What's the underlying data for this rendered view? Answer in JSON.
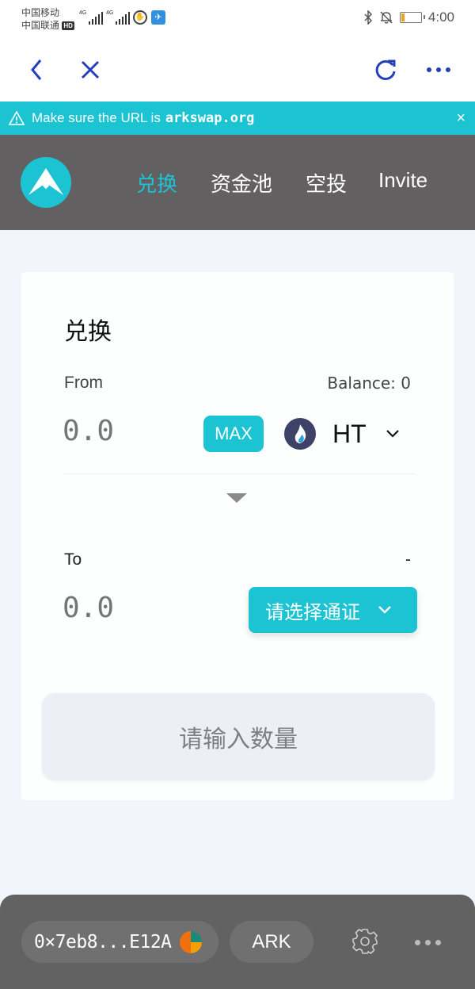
{
  "status_bar": {
    "carrier_1": "中国移动",
    "carrier_2": "中国联通",
    "hd_badge": "HD",
    "network_1": "4G",
    "network_2": "4G",
    "battery_level_percent": 15,
    "time": "4:00"
  },
  "browser": {
    "back_icon": "chevron-left-icon",
    "close_icon": "close-icon",
    "refresh_icon": "refresh-icon",
    "more_icon": "more-horizontal-icon"
  },
  "url_warning": {
    "message": "Make sure the URL is",
    "domain": "arkswap.org",
    "close_label": "×"
  },
  "header": {
    "logo": "arkswap-logo",
    "nav": [
      {
        "label": "兑换",
        "active": true
      },
      {
        "label": "资金池",
        "active": false
      },
      {
        "label": "空投",
        "active": false
      },
      {
        "label": "Invite",
        "active": false
      }
    ],
    "active_color": "#1cc3d3"
  },
  "swap": {
    "title": "兑换",
    "from": {
      "label": "From",
      "balance": "Balance: 0",
      "amount_placeholder": "0.0",
      "max_label": "MAX",
      "token": "HT"
    },
    "to": {
      "label": "To",
      "balance": "-",
      "amount_placeholder": "0.0",
      "select_label": "请选择通证"
    },
    "submit_label": "请输入数量"
  },
  "bottom_bar": {
    "account": "0×7eb8...E12A",
    "network": "ARK"
  },
  "colors": {
    "accent": "#1cc3d3",
    "header_bg": "#626060",
    "browser_icon": "#2440b8"
  }
}
